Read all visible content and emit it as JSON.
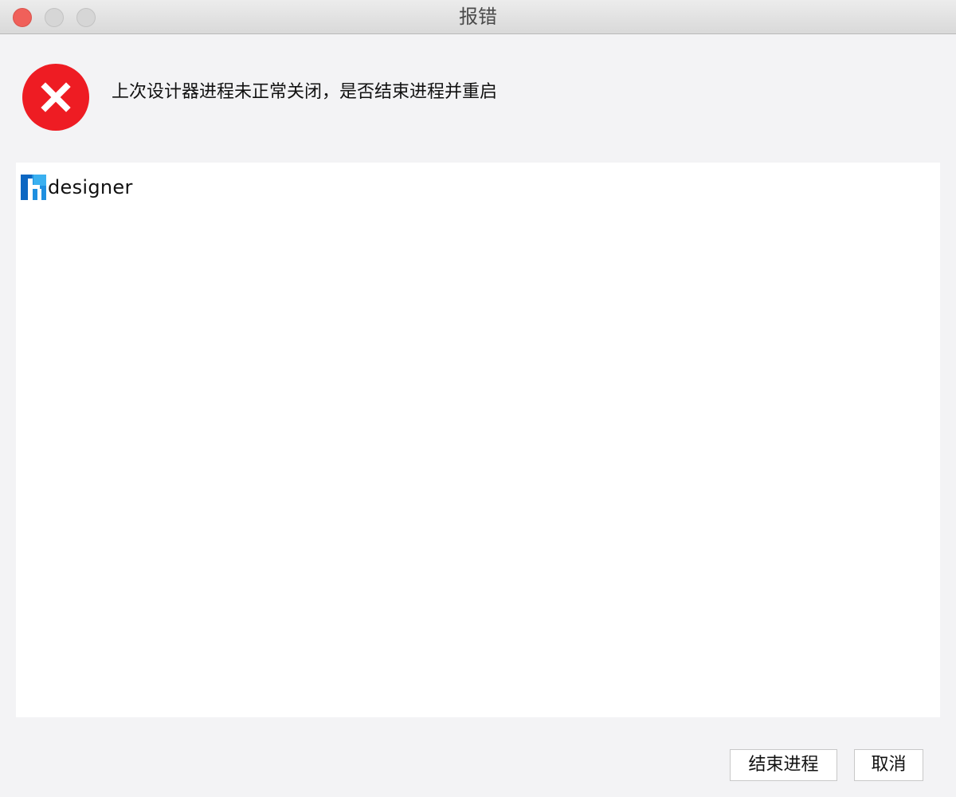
{
  "window": {
    "title": "报错",
    "close_color": "#f0605a",
    "inactive_button_color": "#d6d6d6"
  },
  "dialog": {
    "icon": "error-x-icon",
    "icon_color": "#ee1c23",
    "message": "上次设计器进程未正常关闭，是否结束进程并重启"
  },
  "process_list": {
    "items": [
      {
        "icon": "designer-app-icon",
        "label": "designer"
      }
    ]
  },
  "buttons": {
    "end_process": "结束进程",
    "cancel": "取消"
  }
}
